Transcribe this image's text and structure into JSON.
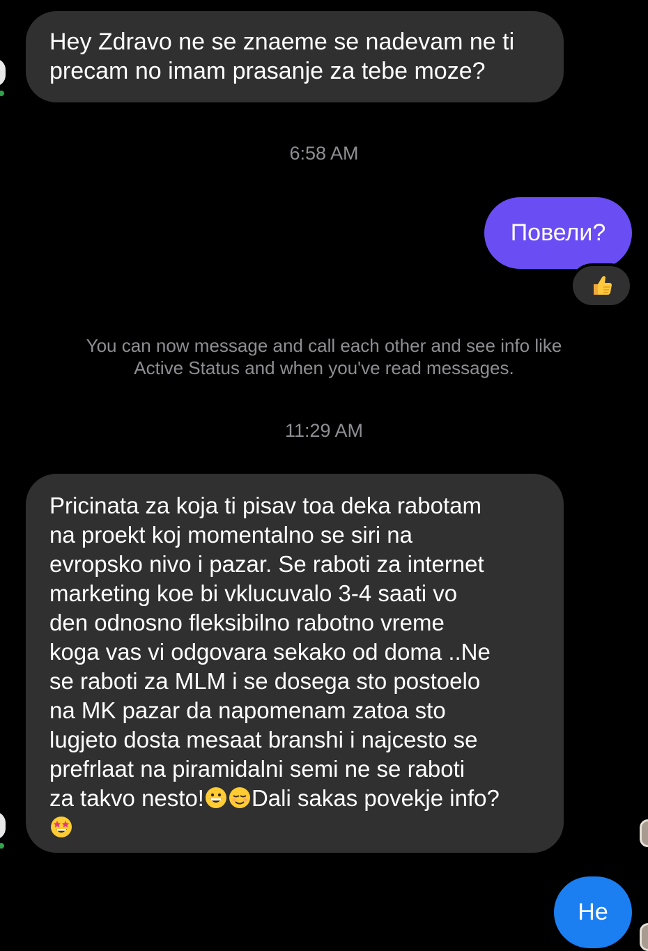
{
  "conversation": {
    "messages": [
      {
        "sender": "other",
        "text": "Hey Zdravo ne se znaeme se nadevam ne ti\nprecam no imam prasanje za tebe moze?"
      },
      {
        "sender": "me",
        "text": "Повели?",
        "reaction": "thumbs-up"
      },
      {
        "sender": "other",
        "text_main": "Pricinata za koja ti pisav toa deka rabotam\nna proekt koj momentalno se siri na\nevropsko nivo i pazar. Se raboti za  internet\nmarketing koe bi vklucuvalo 3-4 saati vo\nden odnosno fleksibilno rabotno vreme\nkoga vas vi odgovara sekako od doma ..Ne\nse raboti za MLM i se dosega sto postoelo\nna MK pazar da napomenam zatoa sto\nlugjeto dosta mesaat branshi i najcesto se\nprefrlaat na piramidalni semi ne se raboti\nza takvo nesto!",
        "text_tail": "Dali sakas povekje info?",
        "emojis": [
          "grinning-face",
          "relieved-face",
          "star-struck-face"
        ]
      },
      {
        "sender": "me",
        "text": "Не"
      }
    ],
    "timestamps": [
      "6:58 AM",
      "11:29 AM"
    ],
    "system_notice": "You can now message and call each other and see info like\nActive Status and when you've read messages."
  },
  "colors": {
    "background": "#000000",
    "incoming_bubble": "#303030",
    "outgoing_bubble_purple": "#6a4df3",
    "outgoing_bubble_blue": "#1b7ff2",
    "secondary_text": "#8e8e93",
    "presence_green": "#31a24c"
  }
}
